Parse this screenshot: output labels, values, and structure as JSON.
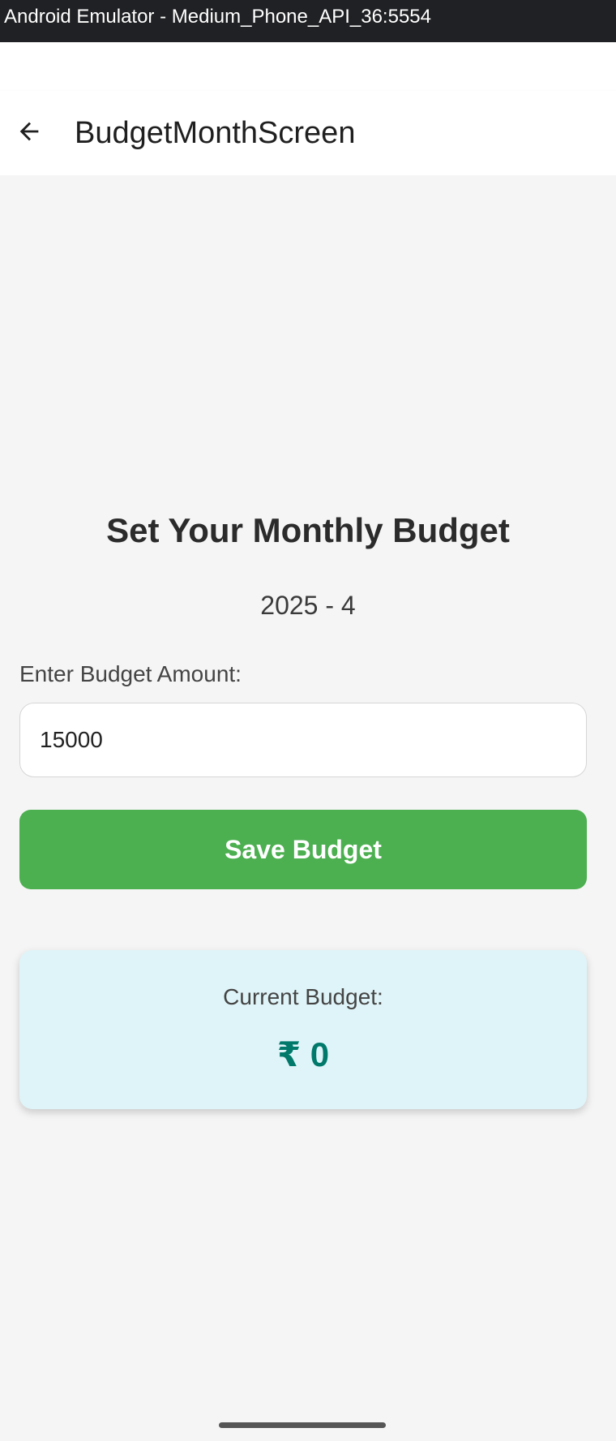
{
  "emulator": {
    "title": "Android Emulator - Medium_Phone_API_36:5554"
  },
  "app_bar": {
    "title": "BudgetMonthScreen",
    "back_icon": "arrow-back-icon"
  },
  "main": {
    "heading": "Set Your Monthly Budget",
    "month": "2025 - 4",
    "input_label": "Enter Budget Amount:",
    "input_value": "15000",
    "save_label": "Save Budget"
  },
  "current_budget": {
    "label": "Current Budget:",
    "value": "₹ 0"
  },
  "colors": {
    "primary_button": "#4caf50",
    "card_background": "#dff4f8",
    "budget_value": "#00796b",
    "emulator_bar": "#202124"
  }
}
